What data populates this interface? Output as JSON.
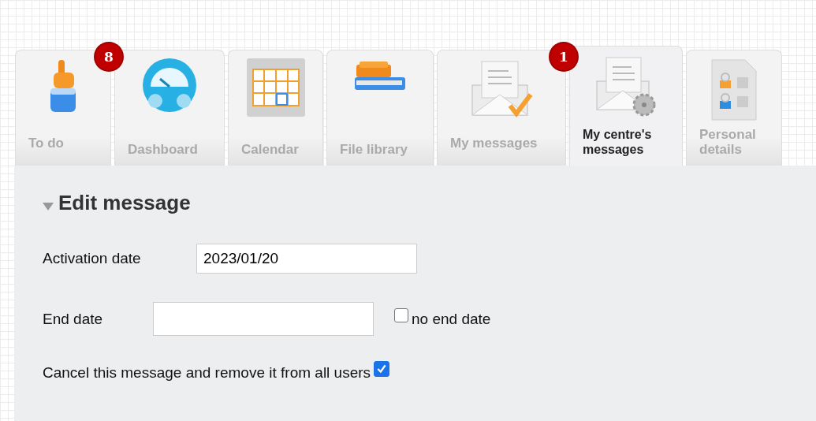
{
  "tabs": [
    {
      "label": "To do",
      "selected": false,
      "badge": "8"
    },
    {
      "label": "Dashboard",
      "selected": false
    },
    {
      "label": "Calendar",
      "selected": false
    },
    {
      "label": "File library",
      "selected": false
    },
    {
      "label": "My messages",
      "selected": false,
      "badge": "1"
    },
    {
      "label": "My centre's messages",
      "selected": true
    },
    {
      "label": "Personal details",
      "selected": false
    }
  ],
  "section": {
    "title": "Edit message",
    "expanded": true
  },
  "fields": [
    {
      "kind": "date",
      "label": "Activation date",
      "value": "2023/01/20"
    },
    {
      "kind": "date-optional",
      "label": "End date",
      "option": {
        "label": "no end date",
        "checked": false
      }
    }
  ],
  "cancel": {
    "label": "Cancel this message and remove it from all users",
    "checked": true
  }
}
